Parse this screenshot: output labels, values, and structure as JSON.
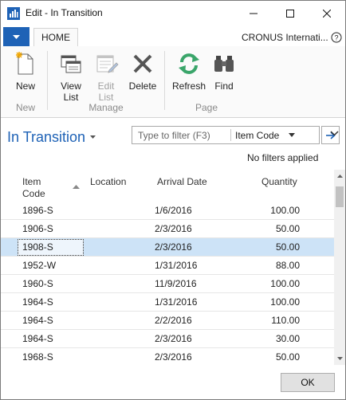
{
  "window": {
    "title": "Edit - In Transition"
  },
  "ribbon": {
    "tab_home": "HOME",
    "company": "CRONUS Internati...",
    "groups": {
      "new": "New",
      "manage": "Manage",
      "page": "Page"
    },
    "buttons": {
      "new": "New",
      "view_list_1": "View",
      "view_list_2": "List",
      "edit_list_1": "Edit",
      "edit_list_2": "List",
      "delete": "Delete",
      "refresh": "Refresh",
      "find": "Find"
    }
  },
  "page": {
    "title": "In Transition",
    "filter_placeholder": "Type to filter (F3)",
    "filter_field": "Item Code",
    "no_filters": "No filters applied"
  },
  "grid": {
    "columns": {
      "item_code_1": "Item",
      "item_code_2": "Code",
      "location": "Location",
      "arrival_date": "Arrival Date",
      "quantity": "Quantity"
    },
    "rows": [
      {
        "code": "1896-S",
        "location": "",
        "date": "1/6/2016",
        "qty": "100.00"
      },
      {
        "code": "1906-S",
        "location": "",
        "date": "2/3/2016",
        "qty": "50.00"
      },
      {
        "code": "1908-S",
        "location": "",
        "date": "2/3/2016",
        "qty": "50.00"
      },
      {
        "code": "1952-W",
        "location": "",
        "date": "1/31/2016",
        "qty": "88.00"
      },
      {
        "code": "1960-S",
        "location": "",
        "date": "11/9/2016",
        "qty": "100.00"
      },
      {
        "code": "1964-S",
        "location": "",
        "date": "1/31/2016",
        "qty": "100.00"
      },
      {
        "code": "1964-S",
        "location": "",
        "date": "2/2/2016",
        "qty": "110.00"
      },
      {
        "code": "1964-S",
        "location": "",
        "date": "2/3/2016",
        "qty": "30.00"
      },
      {
        "code": "1968-S",
        "location": "",
        "date": "2/3/2016",
        "qty": "50.00"
      }
    ],
    "selected_row": 2
  },
  "footer": {
    "ok": "OK"
  },
  "colors": {
    "accent": "#1e62b6",
    "selected_row": "#cde3f7",
    "refresh_green": "#3aa56a"
  }
}
